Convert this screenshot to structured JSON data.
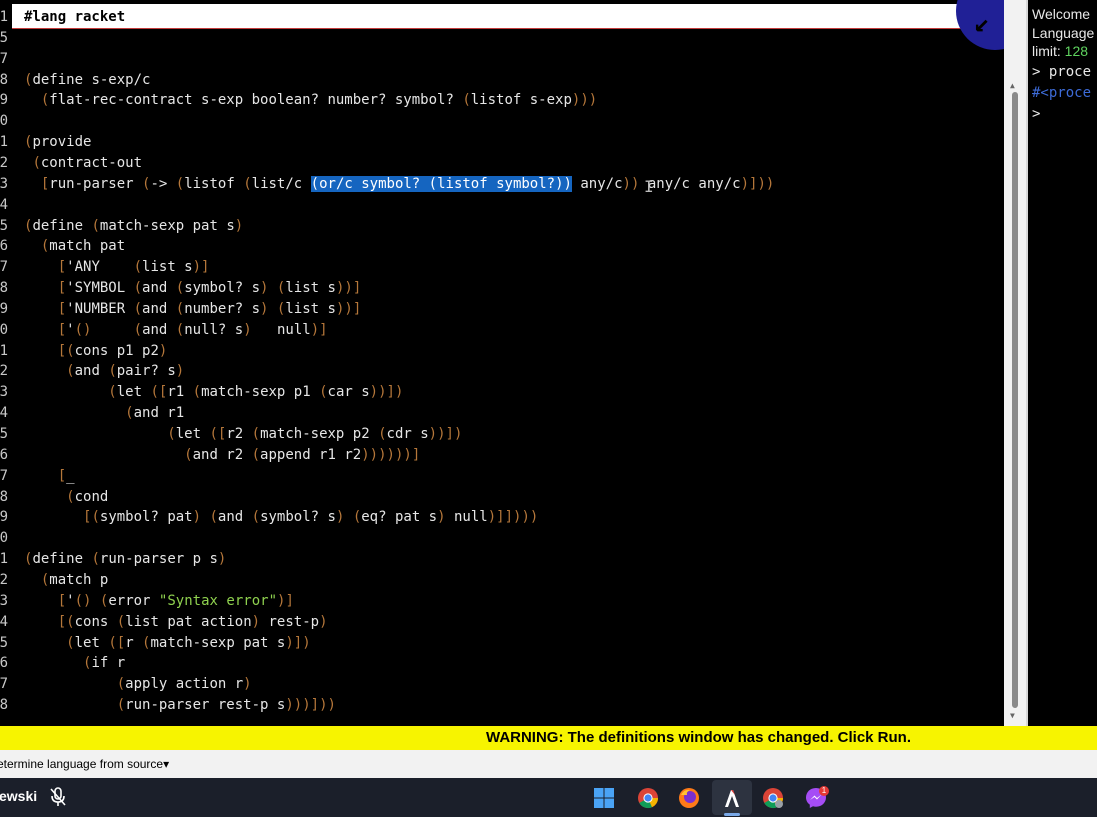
{
  "editor": {
    "line_numbers": [
      "1",
      "5",
      "7",
      "8",
      "9",
      "0",
      "1",
      "2",
      "3",
      "4",
      "5",
      "6",
      "7",
      "8",
      "9",
      "0",
      "1",
      "2",
      "3",
      "4",
      "5",
      "6",
      "7",
      "8",
      "9",
      "0",
      "1",
      "2",
      "3",
      "4",
      "5",
      "6",
      "7",
      "8"
    ],
    "lines": [
      "#lang racket",
      "",
      "",
      "(define s-exp/c",
      "  (flat-rec-contract s-exp boolean? number? symbol? (listof s-exp)))",
      "",
      "(provide",
      " (contract-out",
      "  [run-parser (-> (listof (list/c (or/c symbol? (listof symbol?)) any/c)) any/c any/c)]))",
      "",
      "(define (match-sexp pat s)",
      "  (match pat",
      "    ['ANY    (list s)]",
      "    ['SYMBOL (and (symbol? s) (list s))]",
      "    ['NUMBER (and (number? s) (list s))]",
      "    ['()     (and (null? s)   null)]",
      "    [(cons p1 p2)",
      "     (and (pair? s)",
      "          (let ([r1 (match-sexp p1 (car s))])",
      "            (and r1",
      "                 (let ([r2 (match-sexp p2 (cdr s))])",
      "                   (and r2 (append r1 r2))))))]",
      "    [_",
      "     (cond",
      "       [(symbol? pat) (and (symbol? s) (eq? pat s) null)]])))",
      "",
      "(define (run-parser p s)",
      "  (match p",
      "    ['() (error \"Syntax error\")]",
      "    [(cons (list pat action) rest-p)",
      "     (let ([r (match-sexp pat s)])",
      "       (if r",
      "           (apply action r)",
      "           (run-parser rest-p s)))]))"
    ],
    "selection": "(or/c symbol? (listof symbol?))"
  },
  "interactions": {
    "welcome": "Welcome",
    "language": "Language",
    "limit_label": "limit:",
    "limit_value": "128",
    "prompt1": "> proce",
    "result1": "#<proce",
    "prompt2": ">"
  },
  "warning": "WARNING: The definitions window has changed. Click Run.",
  "status": {
    "language_select": "etermine language from source",
    "dropdown_arrow": "▾"
  },
  "taskbar": {
    "user": "ewski",
    "badge_count": "1",
    "icons": [
      "mic-muted-icon",
      "windows-start-icon",
      "chrome-icon",
      "firefox-icon",
      "racket-icon",
      "chrome-beta-icon",
      "messenger-icon"
    ]
  },
  "colors": {
    "paren": "#b5773a",
    "string": "#8fd14f",
    "selection": "#1565c0",
    "warning_bg": "#f7f400"
  }
}
